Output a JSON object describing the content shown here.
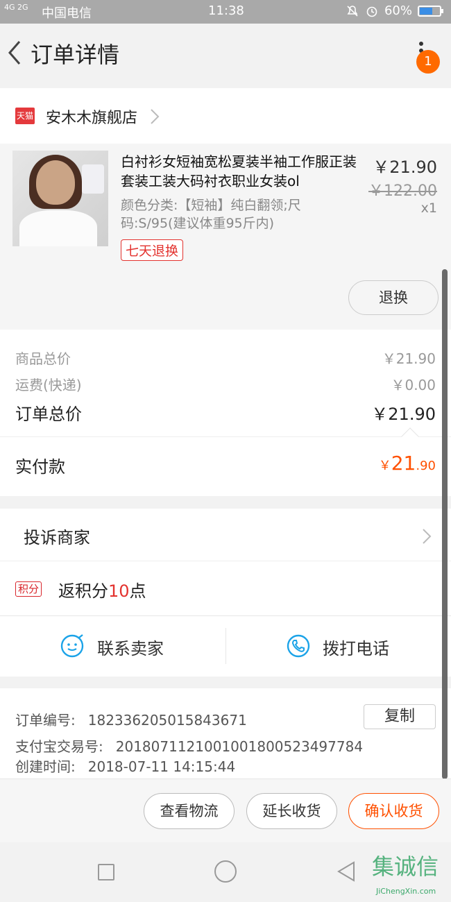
{
  "status_bar": {
    "signal_text": "4G 2G",
    "carrier": "中国电信",
    "time": "11:38",
    "battery": "60%",
    "icons": [
      "alarm-icon",
      "mute-icon",
      "battery-icon"
    ]
  },
  "header": {
    "title": "订单详情",
    "notification_count": "1"
  },
  "store": {
    "logo_text": "天猫",
    "name": "安木木旗舰店"
  },
  "product": {
    "title": "白衬衫女短袖宽松夏装半袖工作服正装套装工装大码衬衣职业女装ol",
    "spec": "颜色分类:【短袖】纯白翻领;尺码:S/95(建议体重95斤内)",
    "tag": "七天退换",
    "price": "￥21.90",
    "original_price": "￥122.00",
    "quantity": "x1",
    "return_button": "退换"
  },
  "summary": {
    "goods_total_label": "商品总价",
    "goods_total_value": "￥21.90",
    "shipping_label": "运费(快递)",
    "shipping_value": "￥0.00",
    "order_total_label": "订单总价",
    "order_total_value": "￥21.90",
    "paid_label": "实付款",
    "paid_currency": "￥",
    "paid_int": "21",
    "paid_dec": ".90"
  },
  "actions": {
    "complain_label": "投诉商家",
    "points_tag": "积分",
    "points_prefix": "返积分",
    "points_value": "10",
    "points_suffix": "点",
    "contact_seller": "联系卖家",
    "call_phone": "拨打电话"
  },
  "order_info": {
    "order_no_label": "订单编号:",
    "order_no_value": "182336205015843671",
    "copy_button": "复制",
    "alipay_label": "支付宝交易号:",
    "alipay_value": "2018071121001001800523497784",
    "created_label": "创建时间:",
    "created_value": "2018-07-11 14:15:44"
  },
  "bottom_bar": {
    "view_logistics": "查看物流",
    "extend_receipt": "延长收货",
    "confirm_receipt": "确认收货"
  },
  "watermark": {
    "text": "集诚信",
    "sub": "JiChengXin.com"
  },
  "colors": {
    "accent": "#ff5000",
    "tmall_red": "#e4393c",
    "icon_blue": "#1ba3e8"
  }
}
